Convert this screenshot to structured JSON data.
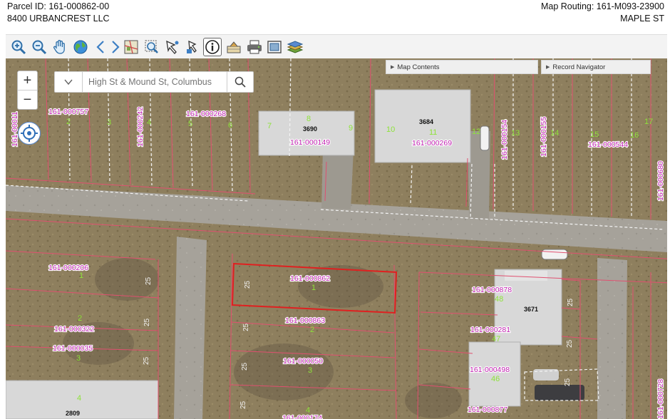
{
  "header": {
    "parcel_id": "Parcel ID: 161-000862-00",
    "owner": "8400 URBANCREST LLC",
    "map_routing": "Map Routing: 161-M093-23900",
    "street": "MAPLE ST"
  },
  "toolbar": {
    "icons": [
      "zoom-in-icon",
      "zoom-out-icon",
      "pan-hand-icon",
      "globe-icon",
      "back-arrow-icon",
      "forward-arrow-icon",
      "map-layer-icon",
      "zoom-box-icon",
      "select-point-icon",
      "identify-icon",
      "info-icon",
      "parcel-icon",
      "print-icon",
      "fullscreen-icon",
      "layers-icon"
    ]
  },
  "map": {
    "zoom_in": "+",
    "zoom_out": "−",
    "search_placeholder": "High St & Mound St, Columbus",
    "panel_map_contents": "Map Contents",
    "panel_record_navigator": "Record Navigator",
    "parcels": {
      "p757": "161-000757",
      "p242": "161-000242",
      "p268": "161-000268",
      "p149": "161-000149",
      "p269": "161-000269",
      "p154": "161-000154",
      "p155": "161-000155",
      "p544": "161-000544",
      "p680": "161-000680",
      "p11x": "161-00011",
      "p206": "161-000206",
      "p322": "161-000322",
      "p035": "161-000035",
      "p862": "161-000862",
      "p863": "161-000863",
      "p050": "161-000050",
      "p878": "161-000878",
      "p281": "161-000281",
      "p498": "161-000498",
      "p877": "161-000877",
      "p728": "161-000728",
      "p174": "161-000174"
    },
    "addresses": {
      "a3690": "3690",
      "a3684": "3684",
      "a3671": "3671",
      "a2809": "2809"
    },
    "lots": {
      "l2": "2",
      "l3": "3",
      "l4": "4",
      "l5": "5",
      "l6": "6",
      "l7": "7",
      "l8": "8",
      "l9": "9",
      "l10": "10",
      "l11": "11",
      "l12": "12",
      "l13": "13",
      "l14": "14",
      "l15": "15",
      "l16": "16",
      "l17": "17",
      "l1a": "1",
      "l2a": "2",
      "l3a": "3",
      "l1b": "1",
      "l2b": "2",
      "l3b": "3",
      "l4b": "4",
      "l48": "48",
      "l47": "47",
      "l46": "46",
      "l4c": "4"
    },
    "dims": {
      "d25": "25"
    }
  }
}
